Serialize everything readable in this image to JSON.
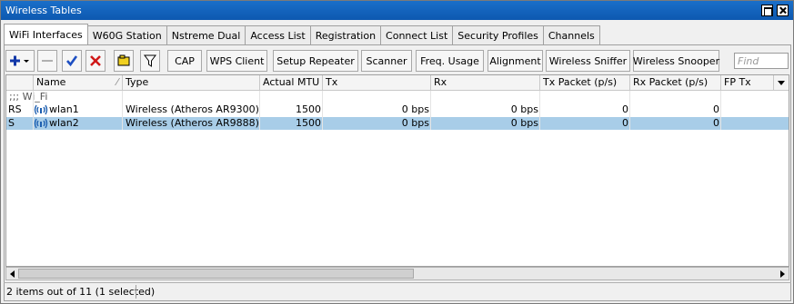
{
  "window": {
    "title": "Wireless Tables"
  },
  "tabs": [
    {
      "label": "WiFi Interfaces",
      "active": true
    },
    {
      "label": "W60G Station"
    },
    {
      "label": "Nstreme Dual"
    },
    {
      "label": "Access List"
    },
    {
      "label": "Registration"
    },
    {
      "label": "Connect List"
    },
    {
      "label": "Security Profiles"
    },
    {
      "label": "Channels"
    }
  ],
  "toolbar": {
    "buttons": [
      "CAP",
      "WPS Client",
      "Setup Repeater",
      "Scanner",
      "Freq. Usage",
      "Alignment",
      "Wireless Sniffer",
      "Wireless Snooper"
    ],
    "find_placeholder": "Find",
    "icons": [
      "add-icon",
      "remove-icon",
      "enable-icon",
      "disable-icon",
      "comment-icon",
      "filter-icon"
    ]
  },
  "table": {
    "columns": [
      "",
      "Name",
      "Type",
      "Actual MTU",
      "Tx",
      "Rx",
      "Tx Packet (p/s)",
      "Rx Packet (p/s)",
      "FP Tx"
    ],
    "comment": ";;; Wi_Fi",
    "rows": [
      {
        "flags": "RS",
        "name": "wlan1",
        "type": "Wireless (Atheros AR9300)",
        "mtu": "1500",
        "tx": "0 bps",
        "rx": "0 bps",
        "tx_packet": "0",
        "rx_packet": "0",
        "fp_tx": "",
        "selected": false
      },
      {
        "flags": "S",
        "name": "wlan2",
        "type": "Wireless (Atheros AR9888)",
        "mtu": "1500",
        "tx": "0 bps",
        "rx": "0 bps",
        "tx_packet": "0",
        "rx_packet": "0",
        "fp_tx": "",
        "selected": true
      }
    ]
  },
  "status": {
    "text": "2 items out of 11 (1 selected)"
  },
  "colors": {
    "title_bar": "#0d58b0",
    "selection": "#a8cde8",
    "add_icon": "#1238a8",
    "check_icon": "#1e4fc2",
    "remove_icon": "#d01818",
    "comment_icon": "#f0d020"
  }
}
